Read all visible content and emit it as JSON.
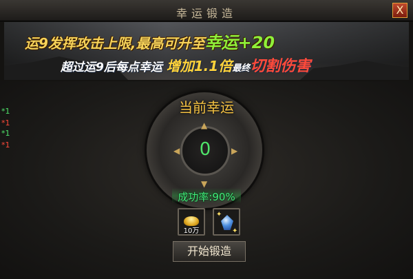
{
  "window": {
    "title": "幸运锻造",
    "close_label": "X"
  },
  "banner": {
    "line1_prefix": "运9发挥攻击上限,最高可升至",
    "line1_highlight": "幸运+20",
    "line2_prefix": "超过运9后每点幸运",
    "line2_increase": "增加1.1倍",
    "line2_mid": "最终",
    "line2_highlight": "切割伤害"
  },
  "side_stats": [
    "*1",
    "*1",
    "*1",
    "*1"
  ],
  "colors": {
    "green": "#4fe36a",
    "red": "#ff4a3a",
    "gold": "#f5c242"
  },
  "luck": {
    "title": "当前幸运",
    "value": "0"
  },
  "success": {
    "label": "成功率:",
    "value": "90%"
  },
  "materials": [
    {
      "icon": "gold-ingot-icon",
      "quantity": "10万"
    },
    {
      "icon": "blue-gem-icon",
      "quantity": ""
    }
  ],
  "forge_button": "开始锻造"
}
